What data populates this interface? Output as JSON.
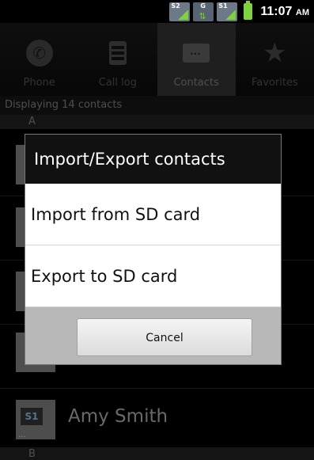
{
  "status_bar": {
    "sim2_tag": "S2",
    "data_tag": "G",
    "sim1_tag": "S1",
    "time": "11:07",
    "ampm": "AM",
    "icons": [
      "sim2-signal-icon",
      "data-transfer-icon",
      "sim1-signal-icon",
      "battery-icon"
    ]
  },
  "tabs": [
    {
      "label": "Phone",
      "icon": "phone-icon"
    },
    {
      "label": "Call log",
      "icon": "call-log-icon"
    },
    {
      "label": "Contacts",
      "icon": "contacts-icon"
    },
    {
      "label": "Favorites",
      "icon": "star-icon"
    }
  ],
  "active_tab": "Contacts",
  "list": {
    "count_text": "Displaying 14 contacts",
    "section_a": "A",
    "section_b": "B",
    "contacts": [
      {
        "name": "Amy Smith",
        "badge": "S1"
      }
    ]
  },
  "dialog": {
    "title": "Import/Export contacts",
    "items": [
      "Import from SD card",
      "Export to SD card"
    ],
    "cancel_label": "Cancel"
  }
}
